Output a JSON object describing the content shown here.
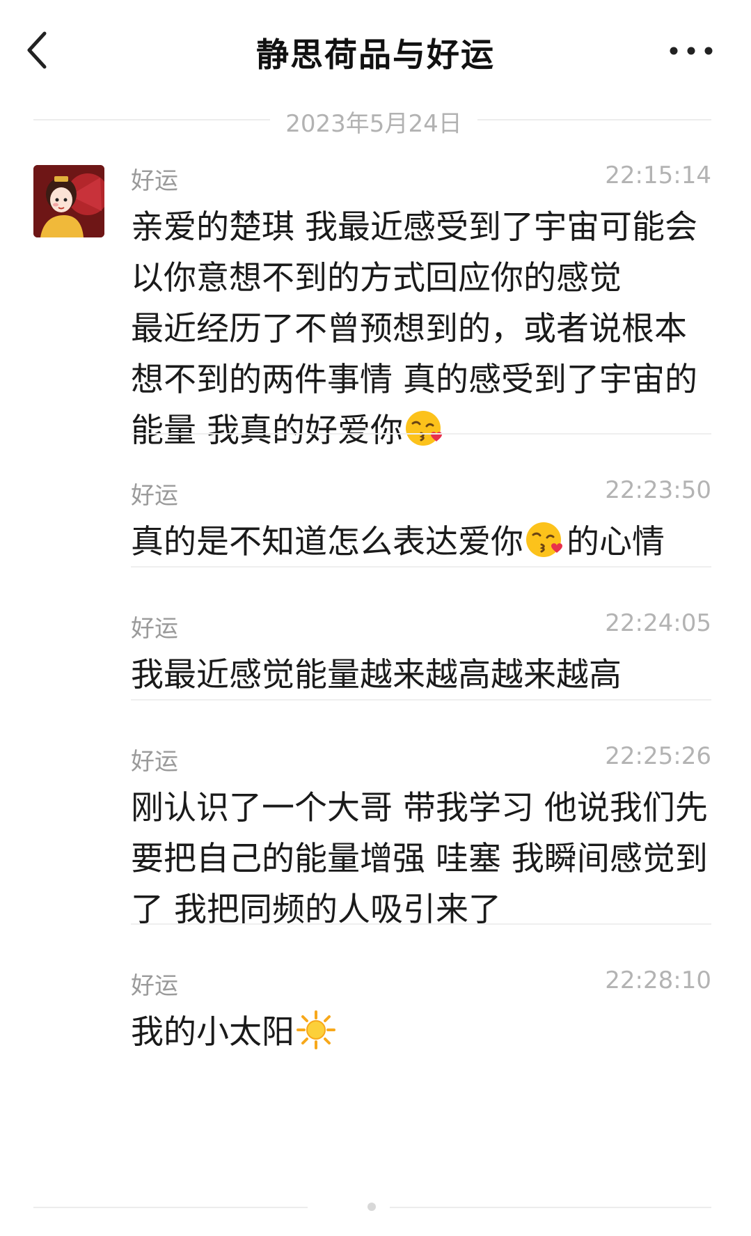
{
  "header": {
    "title": "静思荷品与好运",
    "back_icon": "chevron-left-icon",
    "more_icon": "more-horizontal-icon"
  },
  "date_separator": "2023年5月24日",
  "messages": [
    {
      "sender": "好运",
      "time": "22:15:14",
      "text_before": "亲爱的楚琪 我最近感受到了宇宙可能会以你意想不到的方式回应你的感觉\n最近经历了不曾预想到的，或者说根本想不到的两件事情  真的感受到了宇宙的能量  我真的好爱你",
      "emoji": "face-blowing-kiss-emoji",
      "text_after": ""
    },
    {
      "sender": "好运",
      "time": "22:23:50",
      "text_before": "真的是不知道怎么表达爱你",
      "emoji": "face-blowing-kiss-emoji",
      "text_after": "的心情"
    },
    {
      "sender": "好运",
      "time": "22:24:05",
      "text_before": "我最近感觉能量越来越高越来越高",
      "emoji": "",
      "text_after": ""
    },
    {
      "sender": "好运",
      "time": "22:25:26",
      "text_before": "刚认识了一个大哥 带我学习 他说我们先要把自己的能量增强 哇塞 我瞬间感觉到了 我把同频的人吸引来了",
      "emoji": "",
      "text_after": ""
    },
    {
      "sender": "好运",
      "time": "22:28:10",
      "text_before": "我的小太阳",
      "emoji": "sun-emoji",
      "text_after": ""
    }
  ]
}
